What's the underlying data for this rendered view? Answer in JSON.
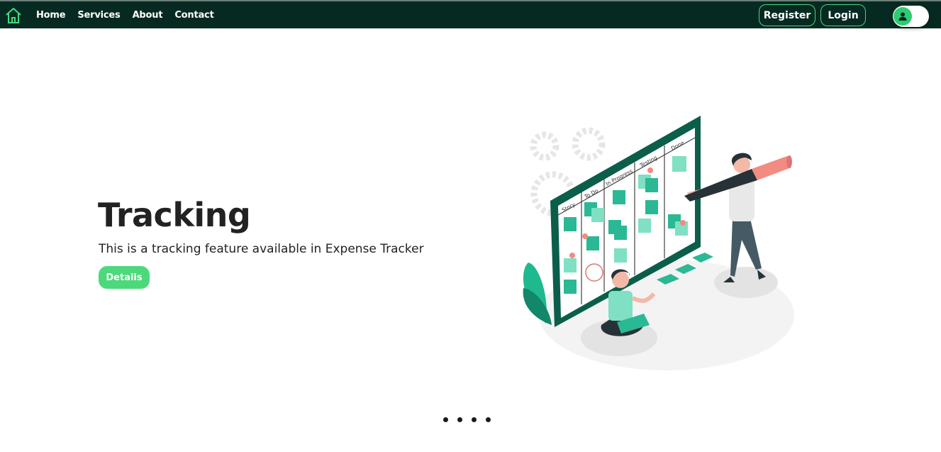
{
  "nav": {
    "links": [
      "Home",
      "Services",
      "About",
      "Contact"
    ],
    "register_label": "Register",
    "login_label": "Login"
  },
  "hero": {
    "title": "Tracking",
    "subtitle": "This is a tracking feature available in Expense Tracker",
    "button_label": "Details"
  },
  "illustration": {
    "board_columns": [
      "Story",
      "To Do",
      "In Progress",
      "Testing",
      "Done"
    ]
  },
  "carousel": {
    "indicator_count": 4
  },
  "colors": {
    "navbar_bg": "#062a21",
    "accent_green": "#4cd97b",
    "board_green": "#0b5e4a",
    "sticky_note": "#2bb894"
  }
}
